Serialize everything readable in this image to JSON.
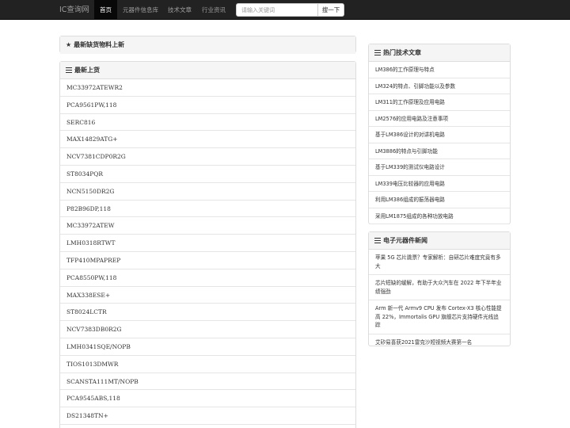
{
  "navbar": {
    "brand": "IC查询网",
    "items": [
      {
        "label": "首页",
        "active": true
      },
      {
        "label": "元器件信息库",
        "active": false
      },
      {
        "label": "技术文章",
        "active": false
      },
      {
        "label": "行业资讯",
        "active": false
      }
    ],
    "search_placeholder": "请输入关键词",
    "search_button": "搜一下"
  },
  "notice": {
    "icon": "star-icon",
    "title": "最新缺货物料上新"
  },
  "latest": {
    "icon": "list-icon",
    "title": "最新上货",
    "items": [
      "MC33972ATEWR2",
      "PCA9561PW,118",
      "SERC816",
      "MAX14829ATG+",
      "NCV7381CDP0R2G",
      "ST8034PQR",
      "NCN5150DR2G",
      "P82B96DP,118",
      "MC33972ATEW",
      "LMH0318RTWT",
      "TFP410MPAPREP",
      "PCA8550PW,118",
      "MAX338ESE+",
      "ST8024LCTR",
      "NCV7383DB0R2G",
      "LMH0341SQE/NOPB",
      "TIOS1013DMWR",
      "SCANSTA111MT/NOPB",
      "PCA9545ABS,118",
      "DS21348TN+"
    ]
  },
  "articles": {
    "icon": "list-icon",
    "title": "热门技术文章",
    "items": [
      "LM386的工作原理与特点",
      "LM324的特点、引脚功能以及参数",
      "LM311的工作原理及应用电路",
      "LM2576的应用电路及注意事项",
      "基于LM386设计的对讲机电路",
      "LM3886的特点与引脚功能",
      "基于LM339的测试仪电路设计",
      "LM339电压比较器的应用电路",
      "利用LM386组成的振荡器电路",
      "采用LM1875组成的各种功放电路"
    ]
  },
  "news": {
    "icon": "list-icon",
    "title": "电子元器件新闻",
    "items": [
      "苹果 5G 芯片跳票？专家解析：自研芯片难度究竟有多大",
      "芯片短缺的缓解，有助于大众汽车在 2022 年下半年业绩强劲",
      "Arm 新一代 Armv9 CPU 发布 Cortex-X3 核心性能提高 22%，Immortalis GPU 旗舰芯片支持硬件光线追踪",
      "艾矽易喜获2021雷克沙短视频大赛第一名"
    ]
  }
}
